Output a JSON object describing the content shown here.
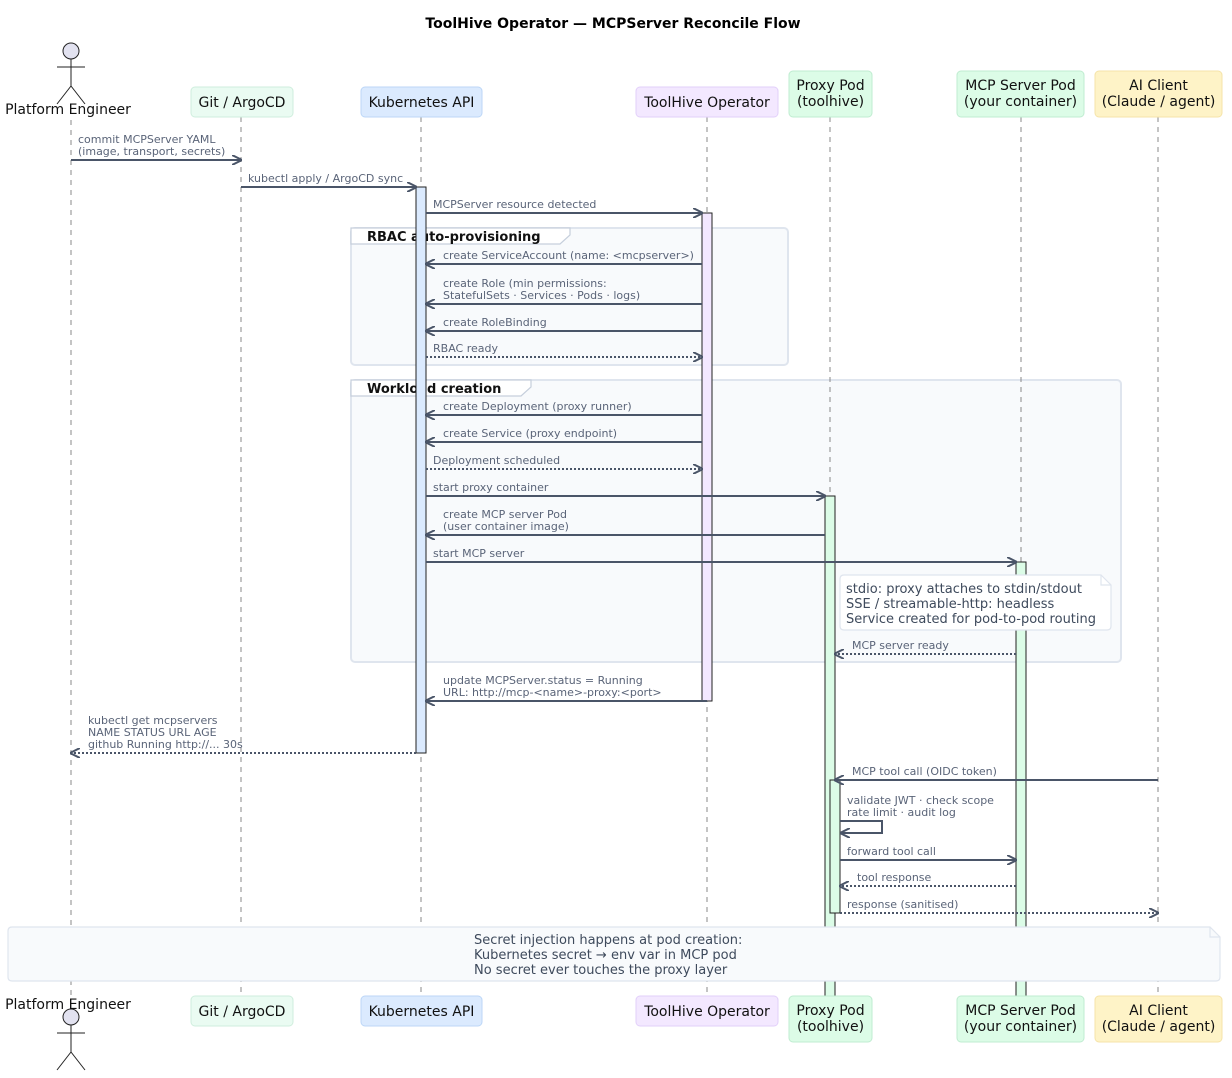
{
  "title": "ToolHive Operator — MCPServer Reconcile Flow",
  "participants": [
    {
      "id": "eng",
      "label": [
        "Platform Engineer"
      ],
      "kind": "actor",
      "fill": "#e2e2f0",
      "stroke": "#222222"
    },
    {
      "id": "git",
      "label": [
        "Git / ArgoCD"
      ],
      "kind": "box",
      "fill": "#eafbf2",
      "stroke": "#cfeedd"
    },
    {
      "id": "k8s",
      "label": [
        "Kubernetes API"
      ],
      "kind": "box",
      "fill": "#dbeafe",
      "stroke": "#bcd6f7"
    },
    {
      "id": "op",
      "label": [
        "ToolHive Operator"
      ],
      "kind": "box",
      "fill": "#f3e8ff",
      "stroke": "#e2cffa"
    },
    {
      "id": "proxy",
      "label": [
        "Proxy Pod",
        "(toolhive)"
      ],
      "kind": "box",
      "fill": "#dcfce7",
      "stroke": "#bfecd0"
    },
    {
      "id": "mcp",
      "label": [
        "MCP Server Pod",
        "(your container)"
      ],
      "kind": "box",
      "fill": "#dcfce7",
      "stroke": "#bfecd0"
    },
    {
      "id": "ai",
      "label": [
        "AI Client",
        "(Claude / agent)"
      ],
      "kind": "box",
      "fill": "#fef3c7",
      "stroke": "#f5e3a8"
    }
  ],
  "groups": [
    {
      "label": "RBAC auto-provisioning"
    },
    {
      "label": "Workload creation"
    }
  ],
  "messages": [
    {
      "from": "eng",
      "to": "git",
      "text": [
        "commit MCPServer YAML",
        "(image, transport, secrets)"
      ],
      "dashed": false
    },
    {
      "from": "git",
      "to": "k8s",
      "text": [
        "kubectl apply / ArgoCD sync"
      ],
      "dashed": false
    },
    {
      "from": "k8s",
      "to": "op",
      "text": [
        "MCPServer resource detected"
      ],
      "dashed": false
    },
    {
      "from": "op",
      "to": "k8s",
      "text": [
        "create ServiceAccount (name: <mcpserver>)"
      ],
      "dashed": false
    },
    {
      "from": "op",
      "to": "k8s",
      "text": [
        "create Role (min permissions:",
        "StatefulSets · Services · Pods · logs)"
      ],
      "dashed": false
    },
    {
      "from": "op",
      "to": "k8s",
      "text": [
        "create RoleBinding"
      ],
      "dashed": false
    },
    {
      "from": "k8s",
      "to": "op",
      "text": [
        "RBAC ready"
      ],
      "dashed": true
    },
    {
      "from": "op",
      "to": "k8s",
      "text": [
        "create Deployment (proxy runner)"
      ],
      "dashed": false
    },
    {
      "from": "op",
      "to": "k8s",
      "text": [
        "create Service (proxy endpoint)"
      ],
      "dashed": false
    },
    {
      "from": "k8s",
      "to": "op",
      "text": [
        "Deployment scheduled"
      ],
      "dashed": true
    },
    {
      "from": "k8s",
      "to": "proxy",
      "text": [
        "start proxy container"
      ],
      "dashed": false
    },
    {
      "from": "proxy",
      "to": "k8s",
      "text": [
        "create MCP server Pod",
        "(user container image)"
      ],
      "dashed": false
    },
    {
      "from": "k8s",
      "to": "mcp",
      "text": [
        "start MCP server"
      ],
      "dashed": false
    },
    {
      "from": "mcp",
      "to": "proxy",
      "text": [
        "MCP server ready"
      ],
      "dashed": true
    },
    {
      "from": "op",
      "to": "k8s",
      "text": [
        "update MCPServer.status = Running",
        "URL: http://mcp-<name>-proxy:<port>"
      ],
      "dashed": false
    },
    {
      "from": "k8s",
      "to": "eng",
      "text": [
        "kubectl get mcpservers",
        "NAME   STATUS    URL     AGE",
        "github Running   http://... 30s"
      ],
      "dashed": true
    },
    {
      "from": "ai",
      "to": "proxy",
      "text": [
        "MCP tool call (OIDC token)"
      ],
      "dashed": false
    },
    {
      "from": "proxy",
      "to": "proxy",
      "text": [
        "validate JWT · check scope",
        "rate limit · audit log"
      ],
      "dashed": false
    },
    {
      "from": "proxy",
      "to": "mcp",
      "text": [
        "forward tool call"
      ],
      "dashed": false
    },
    {
      "from": "mcp",
      "to": "proxy",
      "text": [
        "tool response"
      ],
      "dashed": true
    },
    {
      "from": "proxy",
      "to": "ai",
      "text": [
        "response (sanitised)"
      ],
      "dashed": true
    }
  ],
  "notes": [
    {
      "text": [
        "stdio: proxy attaches to stdin/stdout",
        "SSE / streamable-http: headless",
        "Service created for pod-to-pod routing"
      ]
    },
    {
      "text": [
        "Secret injection happens at pod creation:",
        "Kubernetes secret → env var in MCP pod",
        "No secret ever touches the proxy layer"
      ]
    }
  ],
  "colors": {
    "arrow": "#4a5568",
    "lifeline": "#888888",
    "group_fill": "#f8fafc",
    "group_border": "#dfe5ee",
    "note_fill": "#ffffff",
    "activation_k8s": "#dbeafe",
    "activation_op": "#f3e8ff",
    "activation_proxy": "#dcfce7",
    "activation_mcp": "#dcfce7"
  }
}
